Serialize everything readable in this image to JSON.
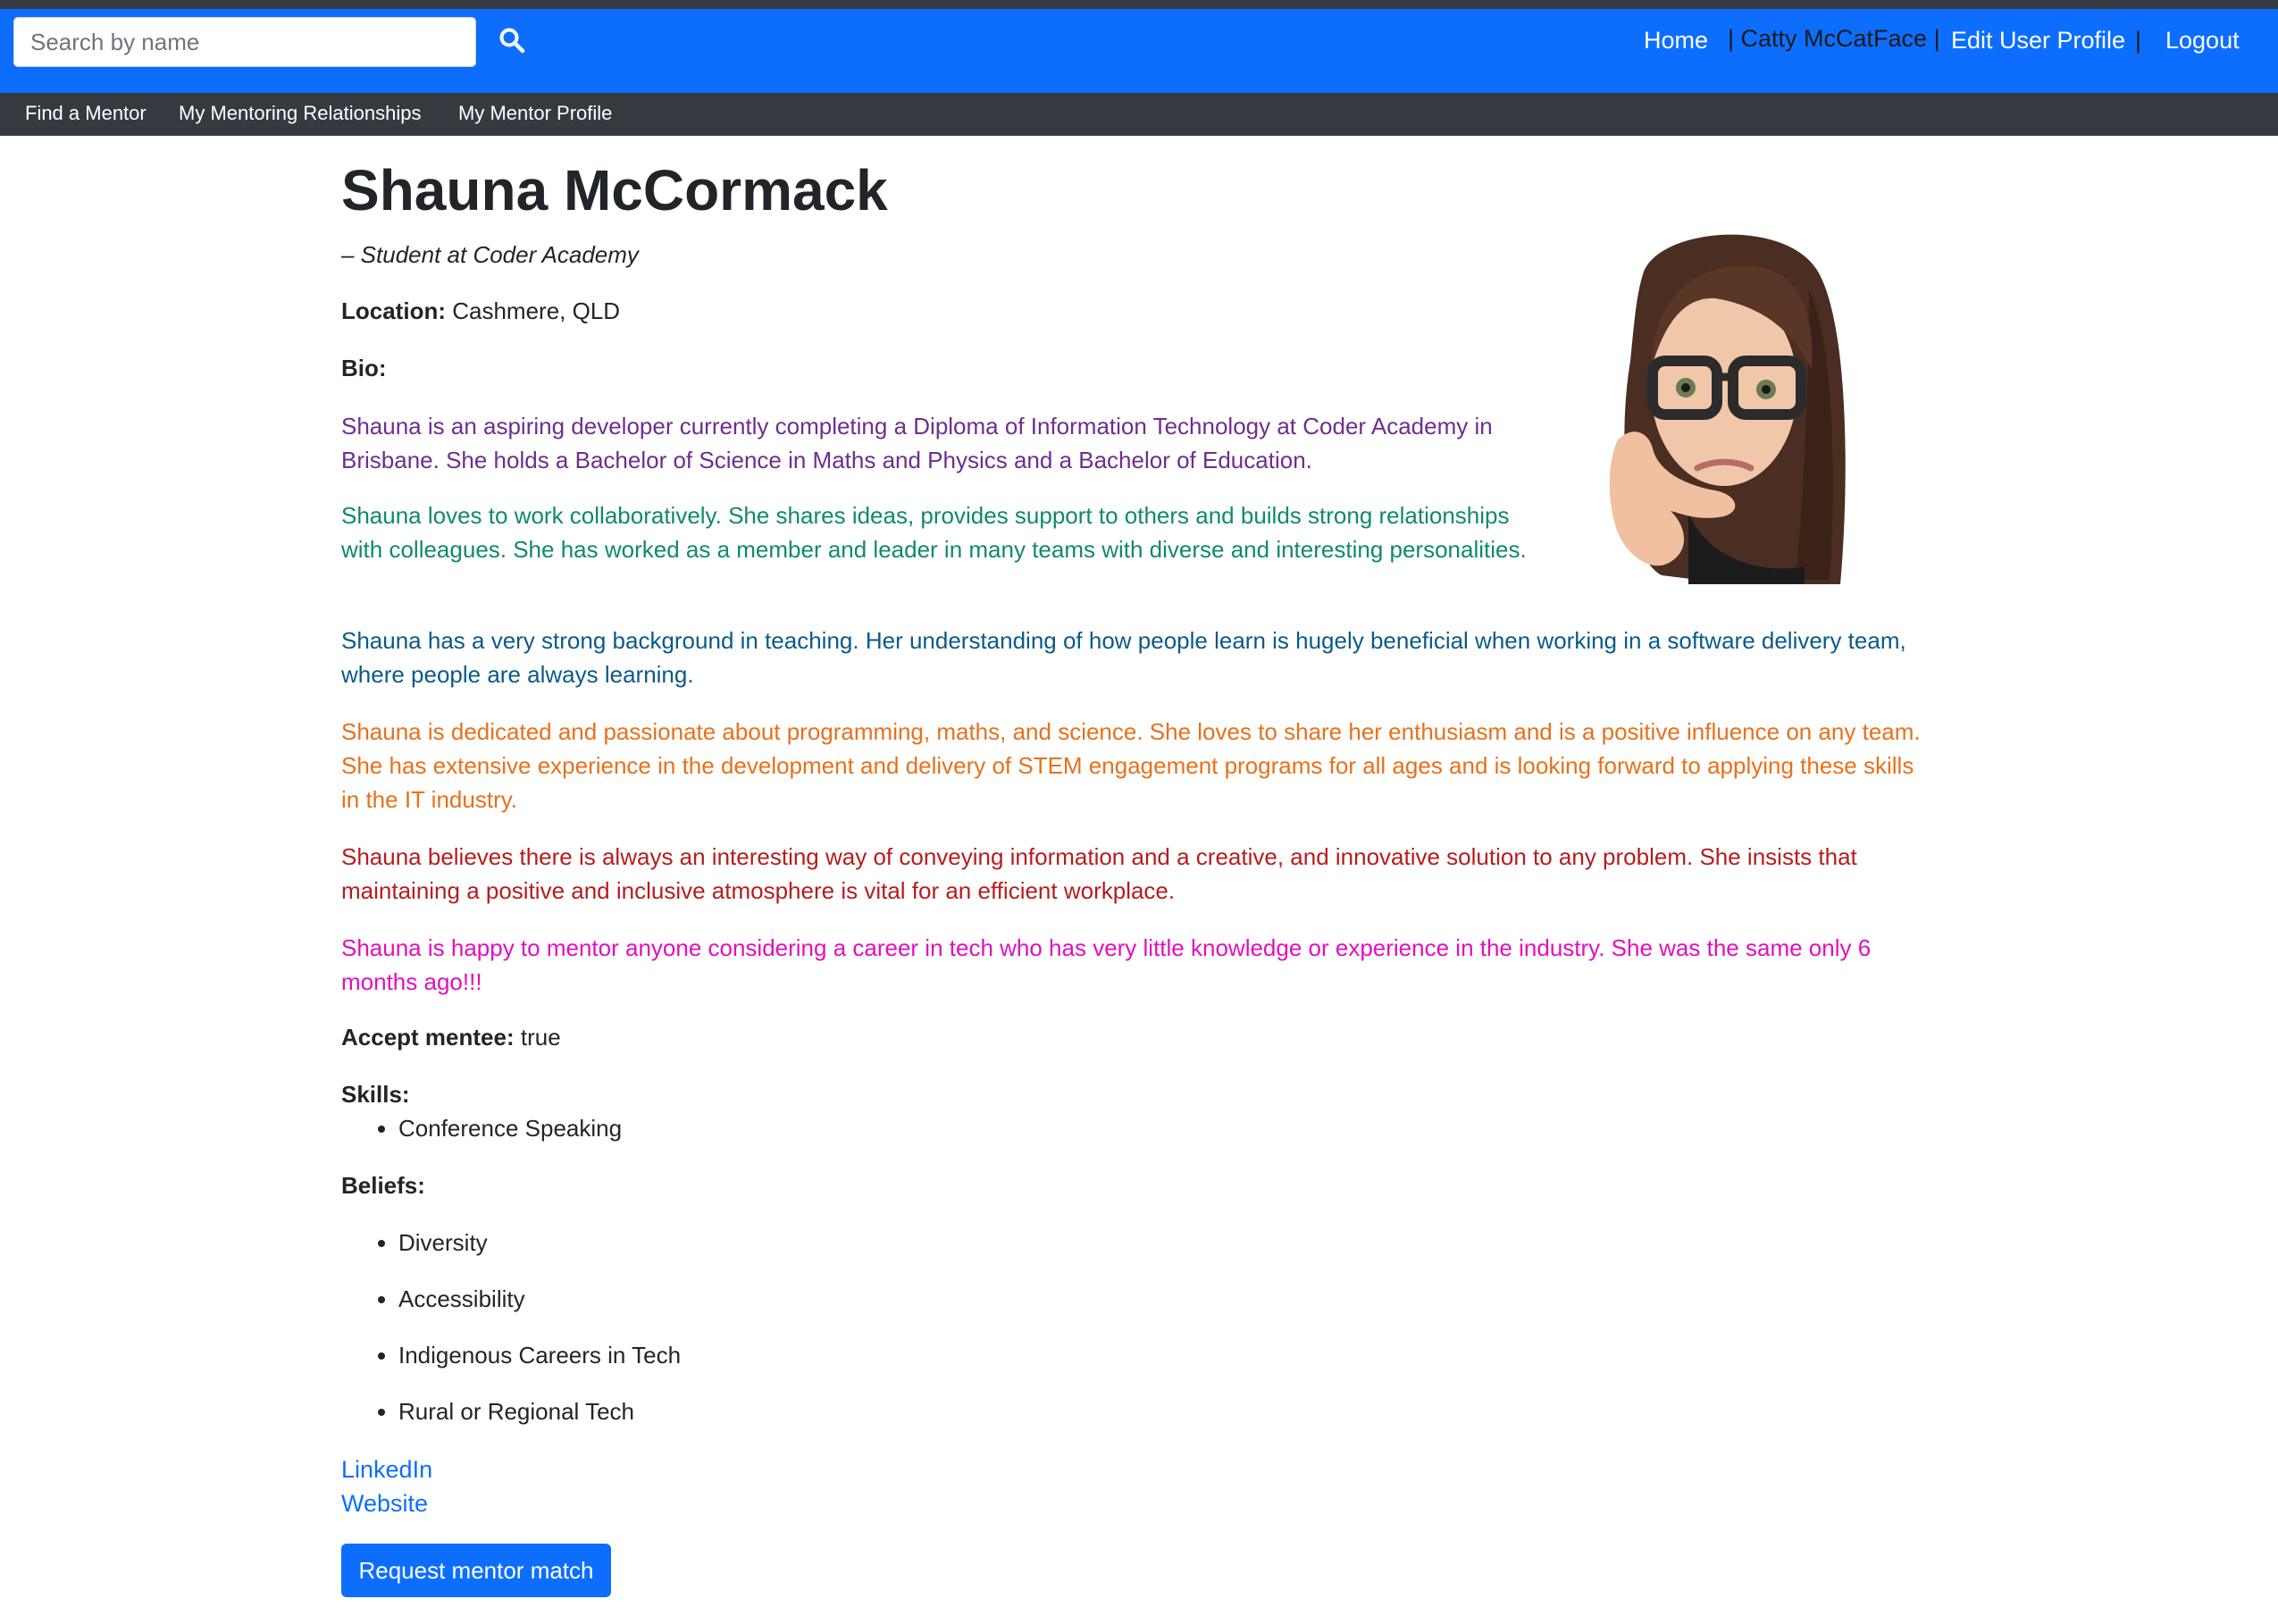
{
  "navbar": {
    "search_placeholder": "Search by name",
    "search_icon": "search-icon",
    "home": "Home",
    "sep1": "|",
    "user": "| Catty McCatFace |",
    "edit_profile": "Edit User Profile",
    "sep2": "|",
    "logout": "Logout"
  },
  "subnav": {
    "items": [
      "Find a Mentor",
      "My Mentoring Relationships",
      "My Mentor Profile"
    ]
  },
  "profile": {
    "name": "Shauna McCormack",
    "subtitle": "– Student at Coder Academy",
    "location_label": "Location:",
    "location_value": "Cashmere, QLD",
    "bio_label": "Bio:",
    "bio": [
      "Shauna is an aspiring developer currently completing a Diploma of Information Technology at Coder Academy in Brisbane. She holds a Bachelor of Science in Maths and Physics and a Bachelor of Education.",
      "Shauna loves to work collaboratively.  She shares ideas, provides support to others and builds strong relationships with colleagues.  She has worked as a member and leader in many teams with diverse and interesting personalities.",
      "Shauna has a very strong background in teaching. Her understanding of how people learn is hugely beneficial when working in a software delivery team, where people are always learning.",
      "Shauna is dedicated and passionate about programming, maths, and science. She loves to share her enthusiasm and is a positive influence on any team. She has extensive experience in the development and delivery of STEM engagement programs for all ages and is looking forward to applying these skills in the IT industry.",
      "Shauna believes there is always an interesting way of conveying information and a creative, and innovative solution to any problem. She insists that maintaining a positive and inclusive atmosphere is vital for an efficient workplace.",
      "Shauna is happy to mentor anyone considering a career in tech who has very little knowledge or experience in the industry. She was the same only 6 months ago!!!"
    ],
    "bio_colors": [
      "#6f2d8f",
      "#0f8a6a",
      "#0a5a8a",
      "#e8701a",
      "#b71c1c",
      "#e10fbf"
    ],
    "accept_label": "Accept mentee:",
    "accept_value": "true",
    "skills_label": "Skills:",
    "skills": [
      "Conference Speaking"
    ],
    "beliefs_label": "Beliefs:",
    "beliefs": [
      "Diversity",
      "Accessibility",
      "Indigenous Careers in Tech",
      "Rural or Regional Tech"
    ],
    "linkedin": "LinkedIn",
    "website": "Website",
    "request_button": "Request mentor match",
    "avatar_icon": "memoji-avatar"
  },
  "colors": {
    "navbar": "#0d6efd",
    "subnav": "#343a40",
    "primary": "#0d6efd"
  }
}
